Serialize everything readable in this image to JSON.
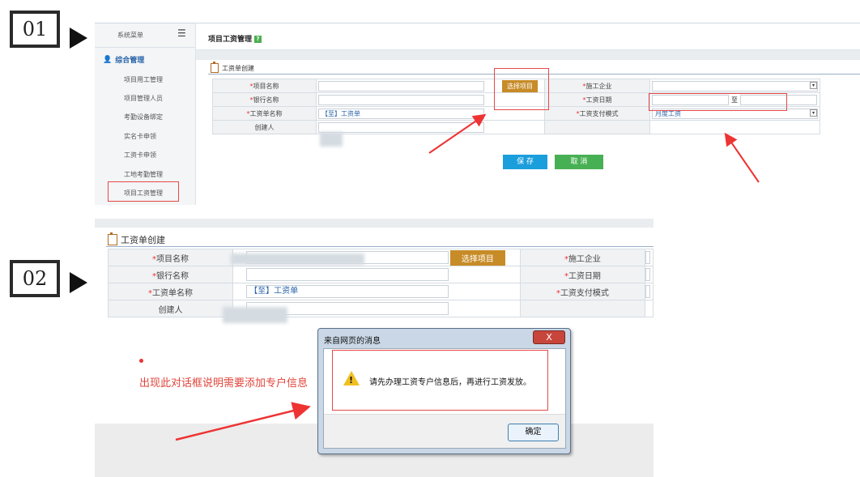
{
  "steps": [
    {
      "label": "01"
    },
    {
      "label": "02"
    }
  ],
  "shot1": {
    "sidebar": {
      "title": "系统菜单",
      "toggle_icon": "menu-toggle-icon",
      "section": "综合管理",
      "items": [
        "项目用工管理",
        "项目管理人员",
        "考勤设备绑定",
        "实名卡申领",
        "工资卡申领",
        "工地考勤管理",
        "项目工资管理"
      ]
    },
    "page_title": "项目工资管理",
    "panel_title": "工资单创建",
    "form": {
      "project_name_label": "项目名称",
      "pick_project_label": "选择项目",
      "company_label": "施工企业",
      "bank_label": "银行名称",
      "pay_date_label": "工资日期",
      "date_sep": "至",
      "sheet_name_label": "工资单名称",
      "sheet_name_value": "【至】工资单",
      "pay_mode_label": "工资支付模式",
      "pay_mode_value": "月度工资",
      "creator_label": "创建人"
    },
    "save_label": "保 存",
    "cancel_label": "取 消"
  },
  "shot2": {
    "panel_title": "工资单创建",
    "form": {
      "project_name_label": "项目名称",
      "pick_project_label": "选择项目",
      "company_label": "施工企业",
      "bank_label": "银行名称",
      "pay_date_label": "工资日期",
      "sheet_name_label": "工资单名称",
      "sheet_name_value": "【至】工资单",
      "pay_mode_label": "工资支付模式",
      "creator_label": "创建人"
    },
    "note": "出现此对话框说明需要添加专户信息",
    "dialog": {
      "title": "来自网页的消息",
      "close_label": "X",
      "message": "请先办理工资专户信息后，再进行工资发放。",
      "ok_label": "确定"
    }
  },
  "colors": {
    "accent_red": "#e84848",
    "pick_button": "#c78b27",
    "save_button": "#1a9edc",
    "cancel_button": "#48b054"
  }
}
